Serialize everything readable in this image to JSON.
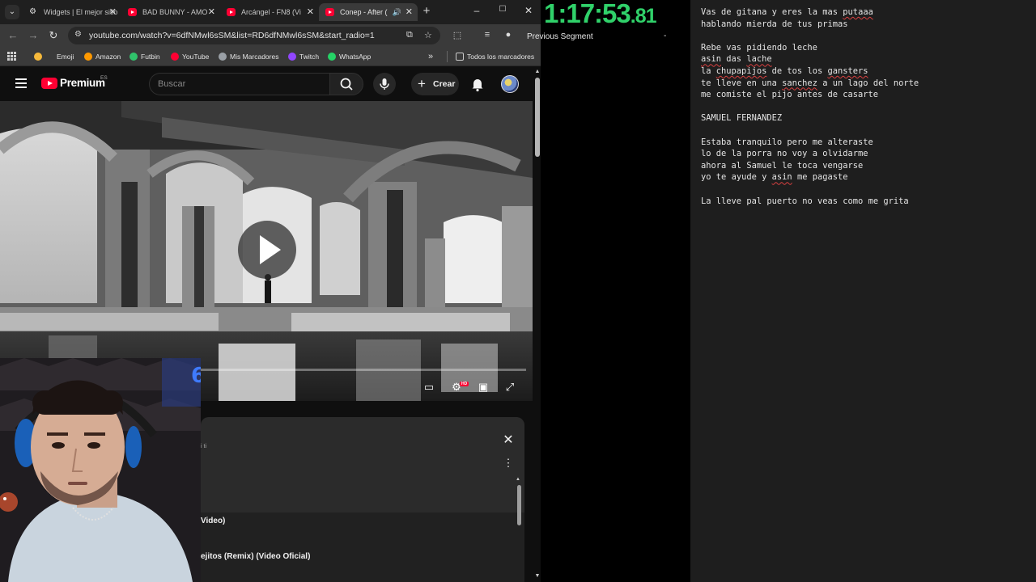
{
  "browser": {
    "tabs": [
      {
        "title": "Widgets | El mejor sitio",
        "favicon": "gear-icon",
        "active": false
      },
      {
        "title": "BAD BUNNY - AMO",
        "favicon": "youtube-icon",
        "active": false
      },
      {
        "title": "Arcángel - FN8 (Vi",
        "favicon": "youtube-icon",
        "active": false
      },
      {
        "title": "Conep - After (",
        "favicon": "youtube-icon",
        "active": true,
        "audio": true
      }
    ],
    "new_tab": "+",
    "window_controls": {
      "minimize": "–",
      "maximize": "☐",
      "close": "✕"
    },
    "url": "youtube.com/watch?v=6dfNMwl6sSM&list=RD6dfNMwl6sSM&start_radio=1",
    "bookmarks": [
      {
        "label": "Emoji",
        "color": "#f6b93b"
      },
      {
        "label": "Amazon",
        "color": "#ff9900"
      },
      {
        "label": "Futbin",
        "color": "#30c26b"
      },
      {
        "label": "YouTube",
        "color": "#ff0033"
      },
      {
        "label": "Mis Marcadores",
        "color": "#9aa0a6"
      },
      {
        "label": "Twitch",
        "color": "#9146ff"
      },
      {
        "label": "WhatsApp",
        "color": "#25d366"
      }
    ],
    "bookmarks_more": "»",
    "all_bookmarks": "Todos los marcadores"
  },
  "youtube": {
    "brand": "Premium",
    "region": "ES",
    "search_placeholder": "Buscar",
    "create_label": "Crear",
    "video": {
      "progress": 0.0
    },
    "playlist": {
      "subtitle": "i ti",
      "items": [
        "Video)",
        "ejitos (Remix) (Video Oficial)"
      ]
    }
  },
  "timer": {
    "main": "1:17:53",
    "fraction": ".81",
    "previous_segment_label": "Previous Segment",
    "previous_segment_value": "-",
    "color": "#30d16a"
  },
  "notes": {
    "lines": [
      "Vas de gitana y eres la mas putaaa",
      "hablando mierda de tus primas",
      "",
      "Rebe vas pidiendo leche",
      "asin das lache",
      "la chupapijos de tos los gansters",
      "te lleve en una sanchez a un lago del norte",
      "me comiste el pijo antes de casarte",
      "",
      "SAMUEL FERNANDEZ",
      "",
      "Estaba tranquilo pero me alteraste",
      "lo de la porra no voy a olvidarme",
      "ahora al Samuel le toca vengarse",
      "yo te ayude y asin me pagaste",
      "",
      "La lleve pal puerto no veas como me grita"
    ],
    "misspelled": [
      "putaaa",
      "asin",
      "lache",
      "chupapijos",
      "gansters",
      "sanchez"
    ]
  }
}
